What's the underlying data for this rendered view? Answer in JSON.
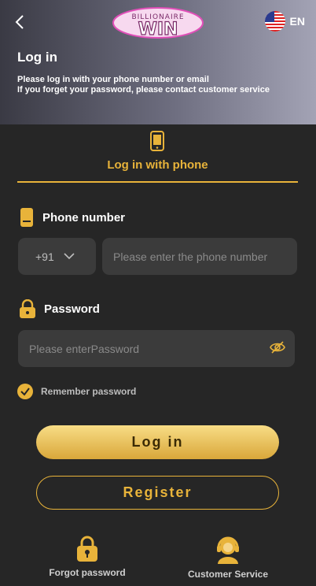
{
  "header": {
    "logo_text_top": "BILLIONAIRE",
    "logo_text_main": "WIN",
    "language": "EN",
    "title": "Log in",
    "description": "Please log in with your phone number or email\nIf you forget your password, please contact customer service"
  },
  "tab": {
    "label": "Log in with phone"
  },
  "phone": {
    "label": "Phone number",
    "country_code": "+91",
    "placeholder": "Please enter the phone number"
  },
  "password": {
    "label": "Password",
    "placeholder": "Please enterPassword"
  },
  "remember": {
    "label": "Remember password",
    "checked": true
  },
  "buttons": {
    "login": "Log in",
    "register": "Register"
  },
  "bottom": {
    "forgot": "Forgot password",
    "service": "Customer Service"
  },
  "colors": {
    "accent": "#e8b33a",
    "background": "#262626",
    "field": "#3b3b3b"
  }
}
